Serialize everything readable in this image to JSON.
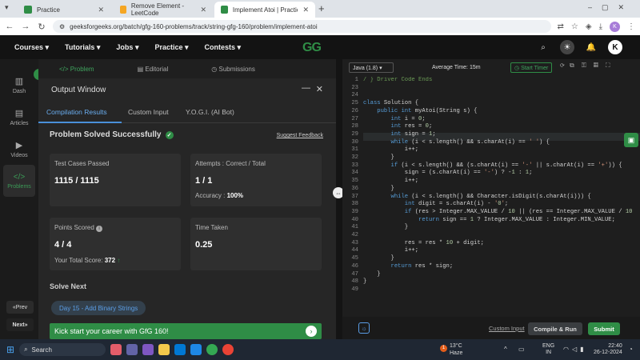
{
  "browser": {
    "tabs": [
      {
        "title": "Practice",
        "active": false,
        "color": "#2f8d46"
      },
      {
        "title": "Remove Element - LeetCode",
        "active": false,
        "color": "#f5a623"
      },
      {
        "title": "Implement Atoi | Practice | Gee",
        "active": true,
        "color": "#2f8d46"
      }
    ],
    "url": "geeksforgeeks.org/batch/gfg-160-problems/track/string-gfg-160/problem/implement-atoi",
    "profile_initial": "K"
  },
  "nav": {
    "items": [
      "Courses",
      "Tutorials",
      "Jobs",
      "Practice",
      "Contests"
    ],
    "logo": "GG",
    "avatar": "K"
  },
  "sidebar": {
    "items": [
      "Dash",
      "Articles",
      "Videos",
      "Problems"
    ],
    "prev": "Prev",
    "next": "Next"
  },
  "problem_tabs": [
    "Problem",
    "Editorial",
    "Submissions"
  ],
  "output": {
    "title": "Output Window",
    "tabs": [
      "Compilation Results",
      "Custom Input",
      "Y.O.G.I. (AI Bot)"
    ],
    "status": "Problem Solved Successfully",
    "suggest": "Suggest Feedback",
    "test_label": "Test Cases Passed",
    "test_value": "1115 / 1115",
    "attempts_label": "Attempts : Correct / Total",
    "attempts_value": "1 / 1",
    "accuracy_label": "Accuracy :",
    "accuracy_value": "100%",
    "points_label": "Points Scored",
    "points_value": "4 / 4",
    "total_label": "Your Total Score:",
    "total_value": "372",
    "time_label": "Time Taken",
    "time_value": "0.25",
    "solve_next": "Solve Next",
    "next_problem": "Day 15 - Add Binary Strings",
    "banner": "Kick start your career with GfG 160!"
  },
  "editor": {
    "language": "Java (1.8)",
    "avg_time": "Average Time: 15m",
    "start_timer": "Start Timer",
    "line_numbers": [
      "1",
      "23",
      "24",
      "25",
      "26",
      "27",
      "28",
      "29",
      "30",
      "31",
      "32",
      "33",
      "34",
      "35",
      "36",
      "37",
      "38",
      "39",
      "40",
      "41",
      "42",
      "43",
      "44",
      "45",
      "46",
      "47",
      "48",
      "49"
    ],
    "code_lines": [
      "/ } Driver Code Ends",
      "",
      "",
      "class Solution {",
      "    public int myAtoi(String s) {",
      "        int i = 0;",
      "        int res = 0;",
      "        int sign = 1;",
      "        while (i < s.length() && s.charAt(i) == ' ') {",
      "            i++;",
      "        }",
      "        if (i < s.length() && (s.charAt(i) == '-' || s.charAt(i) == '+')) {",
      "            sign = (s.charAt(i) == '-') ? -1 : 1;",
      "            i++;",
      "        }",
      "        while (i < s.length() && Character.isDigit(s.charAt(i))) {",
      "            int digit = s.charAt(i) - '0';",
      "            if (res > Integer.MAX_VALUE / 10 || (res == Integer.MAX_VALUE / 10",
      "                return sign == 1 ? Integer.MAX_VALUE : Integer.MIN_VALUE;",
      "            }",
      "",
      "            res = res * 10 + digit;",
      "            i++;",
      "        }",
      "        return res * sign;",
      "    }",
      "}",
      ""
    ],
    "custom_input": "Custom Input",
    "compile_run": "Compile & Run",
    "submit": "Submit"
  },
  "taskbar": {
    "search": "Search",
    "weather_temp": "13°C",
    "weather_text": "Haze",
    "lang1": "ENG",
    "lang2": "IN",
    "time": "22:40",
    "date": "26-12-2024",
    "weather_badge": "1"
  }
}
